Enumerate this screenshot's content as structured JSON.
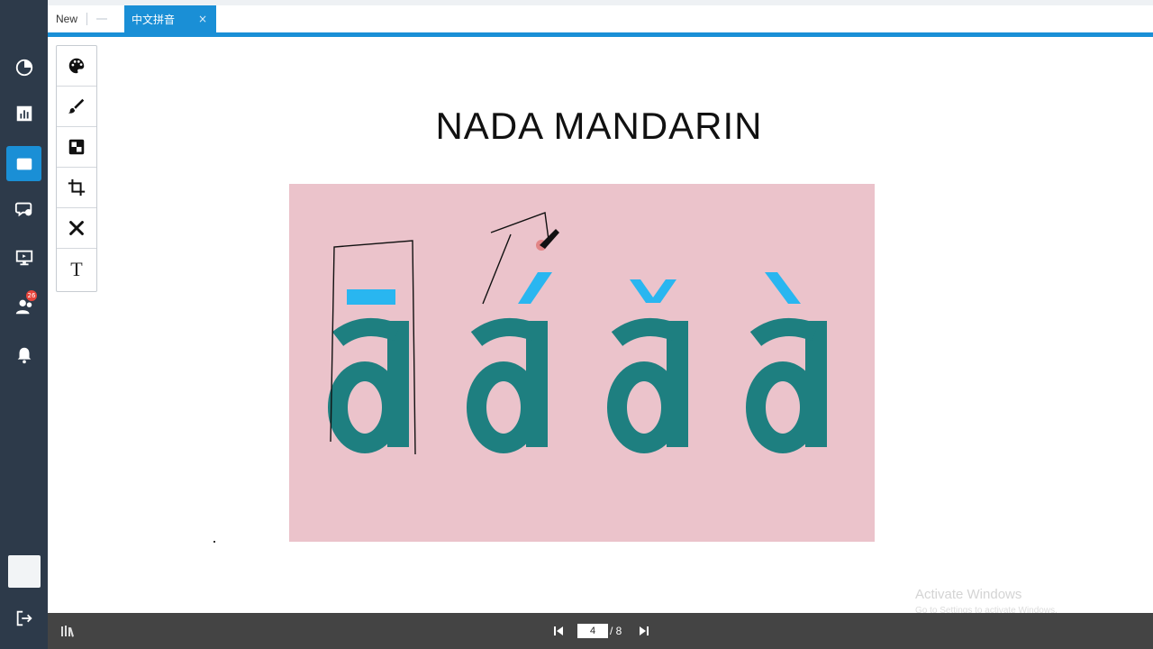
{
  "tabs": [
    {
      "label": "New",
      "active": false
    },
    {
      "label": "中文拼音",
      "active": true,
      "close": "×"
    }
  ],
  "sidebar": {
    "items": [
      {
        "icon": "pie-chart-icon"
      },
      {
        "icon": "bar-chart-icon"
      },
      {
        "icon": "whiteboard-icon",
        "active": true
      },
      {
        "icon": "chat-icon"
      },
      {
        "icon": "screen-share-icon"
      },
      {
        "icon": "participants-icon",
        "badge": "26"
      },
      {
        "icon": "bell-icon"
      }
    ],
    "exit_icon": "logout-icon"
  },
  "toolbar": {
    "tools": [
      "palette-icon",
      "brush-icon",
      "fill-icon",
      "crop-icon",
      "close-icon",
      "text-icon"
    ],
    "text_tool_label": "T"
  },
  "slide": {
    "title": "NADA MANDARIN",
    "letters": [
      "ā",
      "á",
      "ǎ",
      "à"
    ],
    "background": "#ebc3cb",
    "letter_color": "#1e7f80",
    "tone_color": "#29b6f0"
  },
  "pager": {
    "current": "4",
    "total": "/ 8"
  },
  "watermark": {
    "line1": "Activate Windows",
    "line2": "Go to Settings to activate Windows."
  },
  "colors": {
    "accent": "#1a8fd6",
    "sidebar": "#2d3a4a",
    "bottombar": "#444444"
  }
}
